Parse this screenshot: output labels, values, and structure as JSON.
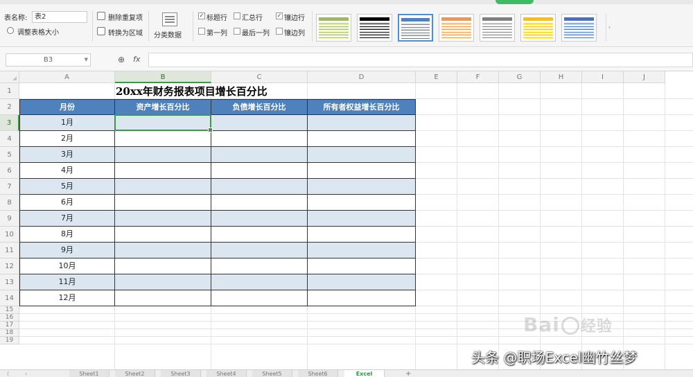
{
  "ribbon": {
    "table_name_label": "表名称:",
    "table_name_value": "表2",
    "resize_table_label": "调整表格大小",
    "remove_duplicates_label": "删除重复项",
    "convert_to_range_label": "转换为区域",
    "fold_data_label": "分类数据",
    "checkboxes": [
      {
        "label": "标题行",
        "checked": true
      },
      {
        "label": "汇总行",
        "checked": false
      },
      {
        "label": "镶边行",
        "checked": true
      },
      {
        "label": "第一列",
        "checked": false
      },
      {
        "label": "最后一列",
        "checked": false
      },
      {
        "label": "镶边列",
        "checked": false
      }
    ],
    "style_swatches": [
      {
        "header": "#9bbb59",
        "band": "#ebf1de",
        "line": "#9bbb59"
      },
      {
        "header": "#000000",
        "band": "#d9d9d9",
        "line": "#000000"
      },
      {
        "header": "#4f81bd",
        "band": "#dce6f1",
        "line": "#4f81bd"
      },
      {
        "header": "#f79646",
        "band": "#fde9d9",
        "line": "#f79646"
      },
      {
        "header": "#7f7f7f",
        "band": "#f2f2f2",
        "line": "#7f7f7f"
      },
      {
        "header": "#ffc000",
        "band": "#fff2cc",
        "line": "#ffc000"
      },
      {
        "header": "#4472c4",
        "band": "#d9e1f2",
        "line": "#4472c4"
      }
    ],
    "selected_style_index": 2
  },
  "formula_bar": {
    "name_box": "B3",
    "fx_label": "fx",
    "formula": ""
  },
  "grid": {
    "columns": [
      "A",
      "B",
      "C",
      "D",
      "E",
      "F",
      "G",
      "H",
      "I",
      "J"
    ],
    "active_column": "B",
    "rows": [
      "1",
      "2",
      "3",
      "4",
      "5",
      "6",
      "7",
      "8",
      "9",
      "10",
      "11",
      "12",
      "13",
      "14",
      "15",
      "16",
      "17",
      "18",
      "19"
    ],
    "active_row": "3"
  },
  "table": {
    "title": "20xx年财务报表项目增长百分比",
    "headers": [
      "月份",
      "资产增长百分比",
      "负债增长百分比",
      "所有者权益增长百分比"
    ],
    "months": [
      "1月",
      "2月",
      "3月",
      "4月",
      "5月",
      "6月",
      "7月",
      "8月",
      "9月",
      "10月",
      "11月",
      "12月"
    ],
    "header_color": "#4f81bd",
    "band_color": "#dce6f1"
  },
  "sheets": {
    "tabs": [
      "Sheet1",
      "Sheet2",
      "Sheet3",
      "Sheet4",
      "Sheet5",
      "Sheet6"
    ],
    "active_tab": "Excel"
  },
  "watermarks": {
    "baidu_left": "Bai",
    "baidu_right": "经验",
    "credit": "头条 @职场Excel幽竹丝梦"
  }
}
